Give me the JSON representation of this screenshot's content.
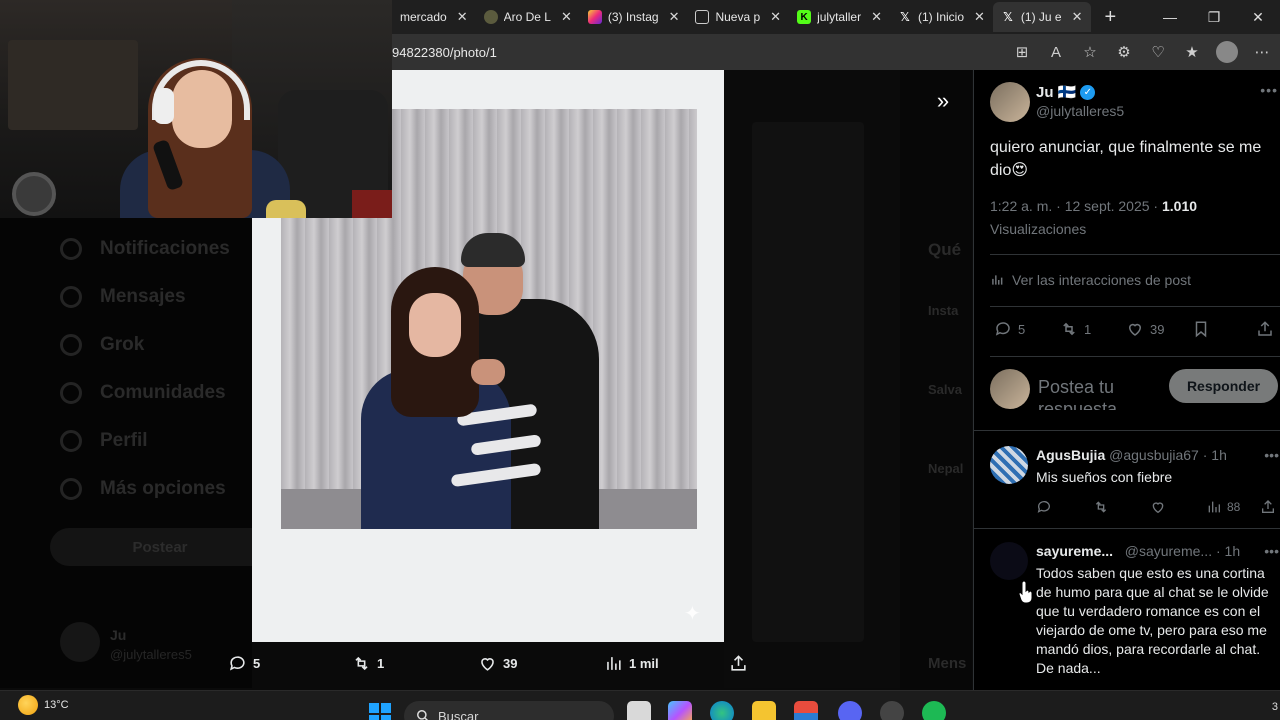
{
  "browser": {
    "tabs": [
      {
        "label": "mercado",
        "favicon": "mercado-icon",
        "active": false
      },
      {
        "label": "Aro De L",
        "favicon": "aro-icon",
        "active": false
      },
      {
        "label": "(3) Instag",
        "favicon": "instagram-icon",
        "active": false
      },
      {
        "label": "Nueva p",
        "favicon": "newtab-icon",
        "active": false
      },
      {
        "label": "julytaller",
        "favicon": "kick-icon",
        "active": false
      },
      {
        "label": "(1) Inicio",
        "favicon": "x-icon",
        "active": false
      },
      {
        "label": "(1) Ju e",
        "favicon": "x-icon",
        "active": true
      }
    ],
    "url": "94822380/photo/1"
  },
  "photo_actions": {
    "replies": "5",
    "reposts": "1",
    "likes": "39",
    "views": "1 mil"
  },
  "background_nav": {
    "items": [
      "Notificaciones",
      "Mensajes",
      "Grok",
      "Comunidades",
      "Perfil",
      "Más opciones"
    ],
    "post_button": "Postear",
    "user_name": "Ju",
    "user_handle": "@julytalleres5"
  },
  "background_right": {
    "heading": "Qué",
    "snippets": [
      "Insta",
      "Salva",
      "Nepal",
      "Mens"
    ]
  },
  "tweet": {
    "author_name": "Ju 🇫🇮",
    "author_handle": "@julytalleres5",
    "text": "quiero anunciar, que finalmente se me dio😍",
    "time": "1:22 a. m. · 12 sept. 2025 · ",
    "views_count": "1.010",
    "views_label": "Visualizaciones",
    "interactions_link": "Ver las interacciones de post",
    "replies": "5",
    "reposts": "1",
    "likes": "39",
    "reply_placeholder": "Postea tu respuesta",
    "reply_button": "Responder"
  },
  "replies": [
    {
      "name": "AgusBujia",
      "handle": "@agusbujia67",
      "time": "· 1h",
      "text": "Mis sueños con fiebre",
      "views": "88"
    },
    {
      "name": "sayureme...",
      "handle": "@sayureme...",
      "time": "· 1h",
      "text": "Todos saben que esto es una cortina de humo para que al chat se le olvide que tu verdadero romance es con el viejardo de ome tv, pero para eso me mandó dios, para recordarle al chat. De nada..."
    }
  ],
  "taskbar": {
    "temperature": "13°C",
    "search_label": "Buscar",
    "corner_text": "3"
  },
  "colors": {
    "accent_blue": "#1d9bf0",
    "panel_bg": "#000000",
    "muted_text": "#71767b",
    "tab_bar": "#1f1f1f"
  }
}
